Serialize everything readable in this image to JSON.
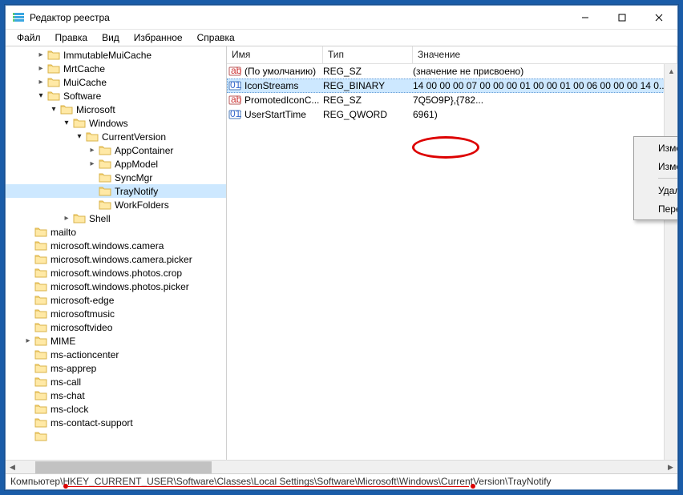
{
  "window": {
    "title": "Редактор реестра"
  },
  "menu": {
    "file": "Файл",
    "edit": "Правка",
    "view": "Вид",
    "favorites": "Избранное",
    "help": "Справка"
  },
  "cols": {
    "name": "Имя",
    "type": "Тип",
    "value": "Значение"
  },
  "rows": [
    {
      "icon": "str",
      "name": "(По умолчанию)",
      "type": "REG_SZ",
      "value": "(значение не присвоено)",
      "sel": false
    },
    {
      "icon": "bin",
      "name": "IconStreams",
      "type": "REG_BINARY",
      "value": "14 00 00 00 07 00 00 00 01 00 00 01 00 06 00 00 00 14 0...",
      "sel": true
    },
    {
      "icon": "str",
      "name": "PromotedIconC...",
      "type": "REG_SZ",
      "value": "7Q5O9P},{782...",
      "sel": false
    },
    {
      "icon": "bin",
      "name": "UserStartTime",
      "type": "REG_QWORD",
      "value": "6961)",
      "sel": false
    }
  ],
  "tree": [
    {
      "d": 2,
      "e": "closed",
      "l": "ImmutableMuiCache"
    },
    {
      "d": 2,
      "e": "closed",
      "l": "MrtCache"
    },
    {
      "d": 2,
      "e": "closed",
      "l": "MuiCache"
    },
    {
      "d": 2,
      "e": "open",
      "l": "Software"
    },
    {
      "d": 3,
      "e": "open",
      "l": "Microsoft"
    },
    {
      "d": 4,
      "e": "open",
      "l": "Windows"
    },
    {
      "d": 5,
      "e": "open",
      "l": "CurrentVersion"
    },
    {
      "d": 6,
      "e": "closed",
      "l": "AppContainer"
    },
    {
      "d": 6,
      "e": "closed",
      "l": "AppModel"
    },
    {
      "d": 6,
      "e": "none",
      "l": "SyncMgr"
    },
    {
      "d": 6,
      "e": "none",
      "l": "TrayNotify",
      "sel": true
    },
    {
      "d": 6,
      "e": "none",
      "l": "WorkFolders"
    },
    {
      "d": 4,
      "e": "closed",
      "l": "Shell"
    },
    {
      "d": 1,
      "e": "none",
      "l": "mailto"
    },
    {
      "d": 1,
      "e": "none",
      "l": "microsoft.windows.camera"
    },
    {
      "d": 1,
      "e": "none",
      "l": "microsoft.windows.camera.picker"
    },
    {
      "d": 1,
      "e": "none",
      "l": "microsoft.windows.photos.crop"
    },
    {
      "d": 1,
      "e": "none",
      "l": "microsoft.windows.photos.picker"
    },
    {
      "d": 1,
      "e": "none",
      "l": "microsoft-edge"
    },
    {
      "d": 1,
      "e": "none",
      "l": "microsoftmusic"
    },
    {
      "d": 1,
      "e": "none",
      "l": "microsoftvideo"
    },
    {
      "d": 1,
      "e": "closed",
      "l": "MIME"
    },
    {
      "d": 1,
      "e": "none",
      "l": "ms-actioncenter"
    },
    {
      "d": 1,
      "e": "none",
      "l": "ms-apprep"
    },
    {
      "d": 1,
      "e": "none",
      "l": "ms-call"
    },
    {
      "d": 1,
      "e": "none",
      "l": "ms-chat"
    },
    {
      "d": 1,
      "e": "none",
      "l": "ms-clock"
    },
    {
      "d": 1,
      "e": "none",
      "l": "ms-contact-support"
    },
    {
      "d": 1,
      "e": "none",
      "l": ""
    }
  ],
  "ctx": {
    "modify": "Изменить...",
    "modbin": "Изменить двоичные данные...",
    "delete": "Удалить",
    "rename": "Переименовать"
  },
  "status": "Компьютер\\HKEY_CURRENT_USER\\Software\\Classes\\Local Settings\\Software\\Microsoft\\Windows\\CurrentVersion\\TrayNotify"
}
